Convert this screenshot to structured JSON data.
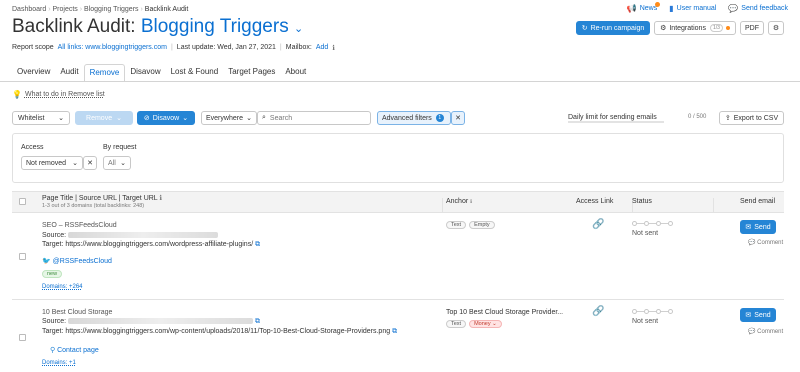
{
  "breadcrumb": [
    "Dashboard",
    "Projects",
    "Blogging Triggers",
    "Backlink Audit"
  ],
  "top_links": {
    "news": "News",
    "manual": "User manual",
    "feedback": "Send feedback"
  },
  "title": {
    "prefix": "Backlink Audit: ",
    "project": "Blogging Triggers"
  },
  "meta": {
    "scope_label": "Report scope",
    "scope_value": "All links: www.bloggingtriggers.com",
    "last_update": "Last update: Wed, Jan 27, 2021",
    "mailbox_label": "Mailbox:",
    "mailbox_add": "Add"
  },
  "actions": {
    "rerun": "Re-run campaign",
    "integrations": "Integrations",
    "integrations_count": "1/3",
    "pdf": "PDF"
  },
  "tabs": [
    "Overview",
    "Audit",
    "Remove",
    "Disavow",
    "Lost & Found",
    "Target Pages",
    "About"
  ],
  "active_tab": "Remove",
  "tip": "What to do in Remove list",
  "toolbar": {
    "whitelist": "Whitelist",
    "remove": "Remove",
    "disavow": "Disavow",
    "scope": "Everywhere",
    "search_placeholder": "Search",
    "advanced": "Advanced filters",
    "advanced_count": "1",
    "daily_limit": "Daily limit for sending emails",
    "daily_value": "0 / 500",
    "export": "Export to CSV"
  },
  "filters": {
    "access_label": "Access",
    "access_value": "Not removed",
    "request_label": "By request",
    "request_value": "All"
  },
  "table": {
    "col_page": "Page Title | Source URL | Target URL",
    "col_page_sub": "1-3 out of 3 domains (total backlinks: 248)",
    "col_anchor": "Anchor",
    "col_access": "Access Link",
    "col_status": "Status",
    "col_send": "Send email"
  },
  "rows": [
    {
      "title": "SEO – RSSFeedsCloud",
      "source_label": "Source:",
      "target": "Target: https://www.bloggingtriggers.com/wordpress-affiliate-plugins/",
      "extra": "@RSSFeedsCloud",
      "badge": "new",
      "domains": "Domains: +264",
      "anchor": "",
      "anchor_tags": [
        "Text",
        "Empty"
      ],
      "status": "Not sent",
      "send": "Send",
      "comment": "Comment"
    },
    {
      "title": "10 Best Cloud Storage",
      "source_label": "Source:",
      "target": "Target: https://www.bloggingtriggers.com/wp-content/uploads/2018/11/Top-10-Best-Cloud-Storage-Providers.png",
      "extra": "Contact page",
      "badge": "",
      "domains": "Domains: +1",
      "anchor": "Top 10 Best Cloud Storage Provider...",
      "anchor_tags": [
        "Text",
        "Money"
      ],
      "status": "Not sent",
      "send": "Send",
      "comment": "Comment"
    }
  ]
}
